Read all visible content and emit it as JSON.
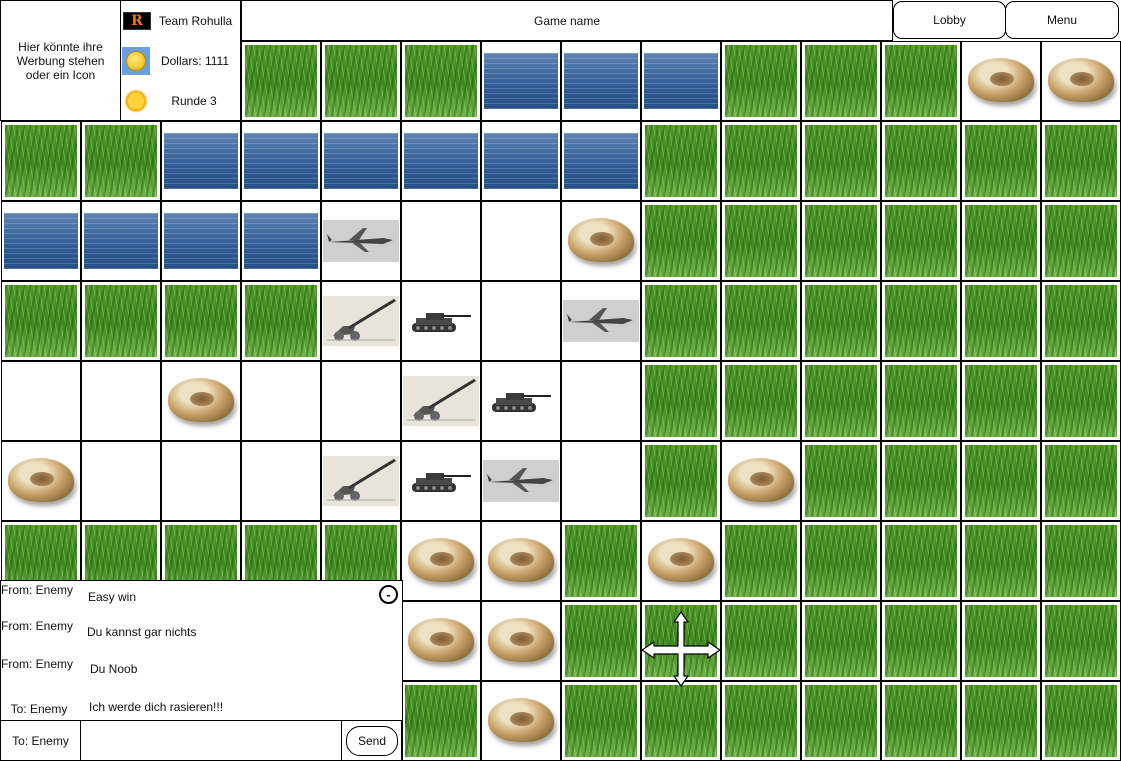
{
  "ad": {
    "text": "Hier könnte ihre Werbung stehen oder ein Icon"
  },
  "player": {
    "team": "Team Rohulla",
    "team_icon_letter": "R",
    "dollars": "Dollars: 1111",
    "round": "Runde 3"
  },
  "header": {
    "game_name": "Game name",
    "lobby_label": "Lobby",
    "menu_label": "Menu"
  },
  "board": {
    "rows": [
      [
        "",
        "",
        "",
        "grass",
        "grass",
        "grass",
        "water",
        "water",
        "water",
        "grass",
        "grass",
        "grass",
        "rock",
        "rock"
      ],
      [
        "grass",
        "grass",
        "water",
        "water",
        "water",
        "water",
        "water",
        "water",
        "grass",
        "grass",
        "grass",
        "grass",
        "grass",
        "grass"
      ],
      [
        "water",
        "water",
        "water",
        "water",
        "plane",
        "empty",
        "empty",
        "rock",
        "grass",
        "grass",
        "grass",
        "grass",
        "grass",
        "grass"
      ],
      [
        "grass",
        "grass",
        "grass",
        "grass",
        "artillery",
        "tank",
        "empty",
        "plane",
        "grass",
        "grass",
        "grass",
        "grass",
        "grass",
        "grass"
      ],
      [
        "empty",
        "empty",
        "rock",
        "empty",
        "empty",
        "artillery",
        "tank",
        "empty",
        "grass",
        "grass",
        "grass",
        "grass",
        "grass",
        "grass"
      ],
      [
        "rock",
        "empty",
        "empty",
        "empty",
        "artillery",
        "tank",
        "plane",
        "empty",
        "grass",
        "rock",
        "grass",
        "grass",
        "grass",
        "grass"
      ],
      [
        "grass",
        "grass",
        "grass",
        "grass",
        "grass",
        "rock",
        "rock",
        "grass",
        "rock",
        "grass",
        "grass",
        "grass",
        "grass",
        "grass"
      ],
      [
        "",
        "",
        "",
        "",
        "",
        "rock",
        "rock",
        "grass",
        "grass",
        "grass",
        "grass",
        "grass",
        "grass",
        "grass"
      ],
      [
        "",
        "",
        "",
        "",
        "",
        "grass",
        "rock",
        "grass",
        "grass",
        "grass",
        "grass",
        "grass",
        "grass",
        "grass"
      ]
    ]
  },
  "chat": {
    "minimize_label": "-",
    "messages": [
      {
        "from": "From: Enemy",
        "text": "Easy win"
      },
      {
        "from": "From: Enemy",
        "text": "Du kannst gar nichts"
      },
      {
        "from": "From: Enemy",
        "text": "Du Noob"
      },
      {
        "from": "To: Enemy",
        "text": "Ich werde dich rasieren!!!"
      }
    ],
    "recipient": "To: Enemy",
    "input_value": "",
    "send_label": "Send"
  },
  "icons": {
    "team": "r-letter-icon",
    "dollars": "coin-icon",
    "round": "sun-icon",
    "move": "move-arrows-icon"
  }
}
